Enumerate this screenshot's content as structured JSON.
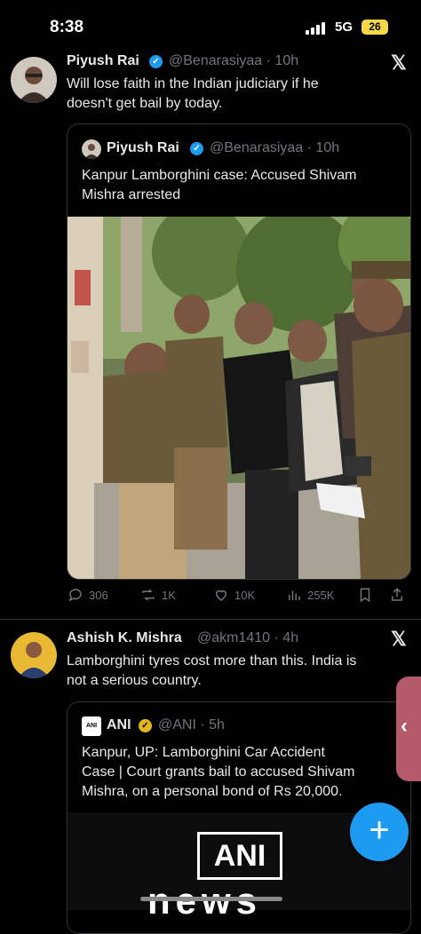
{
  "status_bar": {
    "time": "8:38",
    "network": "5G",
    "battery": "26"
  },
  "posts": [
    {
      "author_name": "Piyush Rai",
      "handle": "@Benarasiyaa",
      "time": "· 10h",
      "text_lines": [
        "Will lose faith in the Indian judiciary if he",
        "doesn't get bail by today."
      ],
      "quote": {
        "author_name": "Piyush Rai",
        "handle": "@Benarasiyaa",
        "time": "· 10h",
        "text_lines": [
          "Kanpur Lamborghini case: Accused Shivam",
          "Mishra arrested"
        ]
      },
      "actions": {
        "replies": "306",
        "reposts": "1K",
        "likes": "10K",
        "views": "255K"
      }
    },
    {
      "author_name": "Ashish K. Mishra",
      "handle": "@akm1410",
      "time": "· 4h",
      "text_lines": [
        "Lamborghini tyres cost more than this. India is",
        "not a serious country."
      ],
      "quote": {
        "author_name": "ANI",
        "handle": "@ANI",
        "time": "· 5h",
        "text_lines": [
          "Kanpur, UP: Lamborghini Car Accident",
          "Case | Court grants bail to accused Shivam",
          "Mishra, on a personal bond of Rs 20,000."
        ],
        "media_logo": "ANI",
        "media_word": "news"
      }
    }
  ],
  "colors": {
    "accent": "#1d9bf0",
    "background": "#000000",
    "muted": "#71767b",
    "gold_badge": "#e2b719"
  },
  "icons": [
    "reply-icon",
    "repost-icon",
    "like-icon",
    "views-icon",
    "bookmark-icon",
    "share-icon",
    "x-logo-icon",
    "compose-icon"
  ]
}
